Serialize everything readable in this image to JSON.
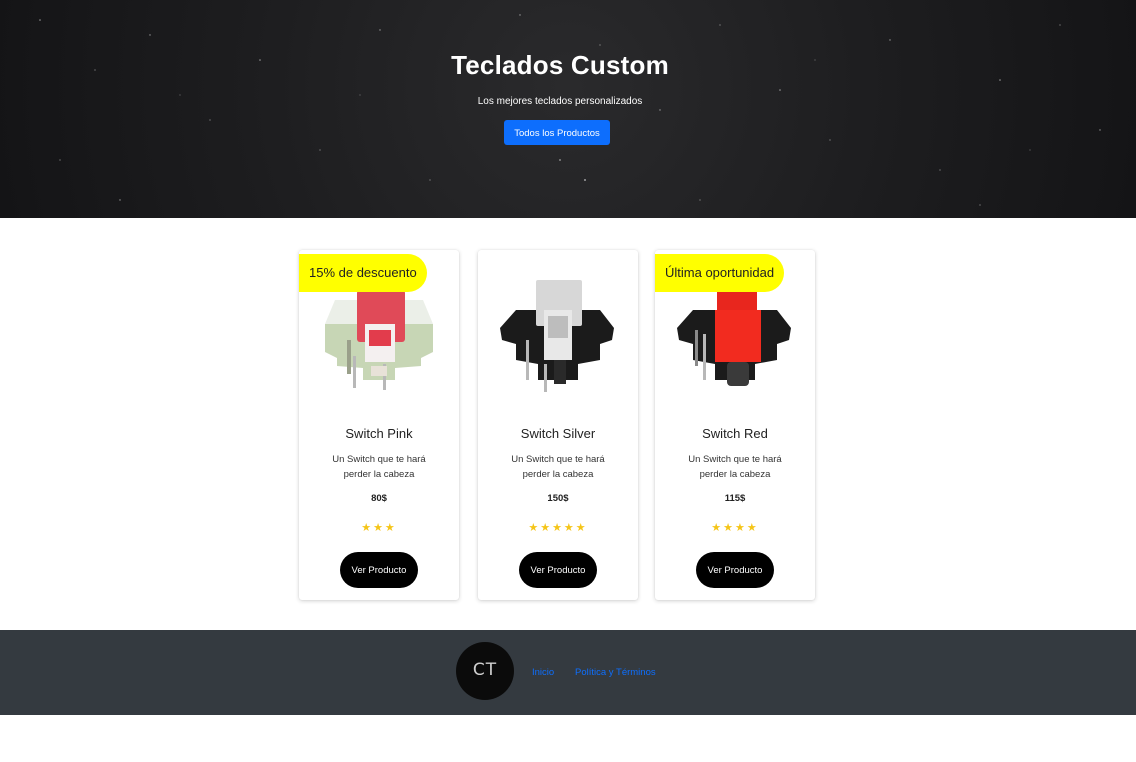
{
  "hero": {
    "title": "Teclados Custom",
    "subtitle": "Los mejores teclados personalizados",
    "button_label": "Todos los Productos"
  },
  "products": [
    {
      "badge": "15% de descuento",
      "name": "Switch Pink",
      "description": "Un Switch que te hará perder la cabeza",
      "price": "80$",
      "rating": 3,
      "stars": "★★★",
      "button_label": "Ver Producto",
      "image": "switch-pink-image"
    },
    {
      "badge": "",
      "name": "Switch Silver",
      "description": "Un Switch que te hará perder la cabeza",
      "price": "150$",
      "rating": 5,
      "stars": "★★★★★",
      "button_label": "Ver Producto",
      "image": "switch-silver-image"
    },
    {
      "badge": "Última oportunidad",
      "name": "Switch Red",
      "description": "Un Switch que te hará perder la cabeza",
      "price": "115$",
      "rating": 4,
      "stars": "★★★★",
      "button_label": "Ver Producto",
      "image": "switch-red-image"
    }
  ],
  "footer": {
    "logo_text": "CT",
    "links": [
      "Inicio",
      "Política y Términos"
    ]
  },
  "colors": {
    "accent": "#0d6efd",
    "badge": "#ffff00",
    "star": "#f5c518",
    "footer_bg": "#343a40"
  }
}
